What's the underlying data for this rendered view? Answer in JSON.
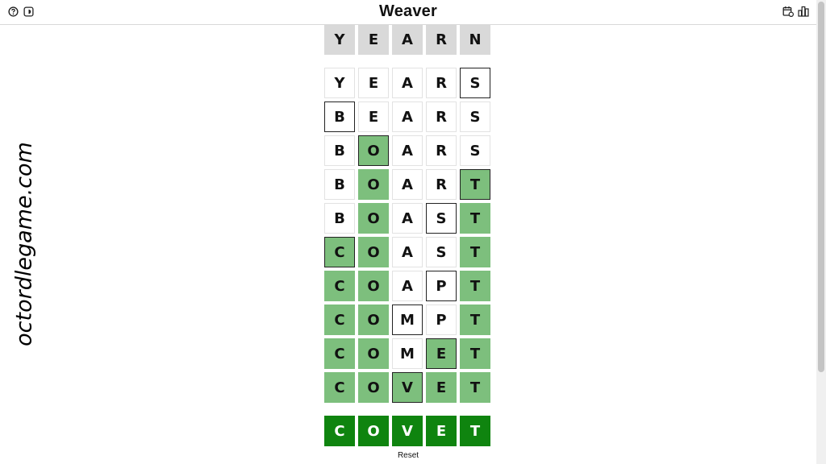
{
  "header": {
    "title": "Weaver",
    "icons": [
      "help-icon",
      "theme-icon",
      "calendar-icon",
      "stats-icon"
    ]
  },
  "watermark": "octordlegame.com",
  "colors": {
    "start": "#d9d9d9",
    "correct": "#7dbf7d",
    "target": "#0f840f"
  },
  "start_word": [
    "Y",
    "E",
    "A",
    "R",
    "N"
  ],
  "guesses": [
    {
      "letters": [
        "Y",
        "E",
        "A",
        "R",
        "S"
      ],
      "states": [
        "plain",
        "plain",
        "plain",
        "plain",
        "changed"
      ]
    },
    {
      "letters": [
        "B",
        "E",
        "A",
        "R",
        "S"
      ],
      "states": [
        "changed",
        "plain",
        "plain",
        "plain",
        "plain"
      ]
    },
    {
      "letters": [
        "B",
        "O",
        "A",
        "R",
        "S"
      ],
      "states": [
        "plain",
        "green-changed",
        "plain",
        "plain",
        "plain"
      ]
    },
    {
      "letters": [
        "B",
        "O",
        "A",
        "R",
        "T"
      ],
      "states": [
        "plain",
        "green",
        "plain",
        "plain",
        "green-changed"
      ]
    },
    {
      "letters": [
        "B",
        "O",
        "A",
        "S",
        "T"
      ],
      "states": [
        "plain",
        "green",
        "plain",
        "changed",
        "green"
      ]
    },
    {
      "letters": [
        "C",
        "O",
        "A",
        "S",
        "T"
      ],
      "states": [
        "green-changed",
        "green",
        "plain",
        "plain",
        "green"
      ]
    },
    {
      "letters": [
        "C",
        "O",
        "A",
        "P",
        "T"
      ],
      "states": [
        "green",
        "green",
        "plain",
        "changed",
        "green"
      ]
    },
    {
      "letters": [
        "C",
        "O",
        "M",
        "P",
        "T"
      ],
      "states": [
        "green",
        "green",
        "changed",
        "plain",
        "green"
      ]
    },
    {
      "letters": [
        "C",
        "O",
        "M",
        "E",
        "T"
      ],
      "states": [
        "green",
        "green",
        "plain",
        "green-changed",
        "green"
      ]
    },
    {
      "letters": [
        "C",
        "O",
        "V",
        "E",
        "T"
      ],
      "states": [
        "green",
        "green",
        "green-changed",
        "green",
        "green"
      ]
    }
  ],
  "target_word": [
    "C",
    "O",
    "V",
    "E",
    "T"
  ],
  "reset_label": "Reset"
}
